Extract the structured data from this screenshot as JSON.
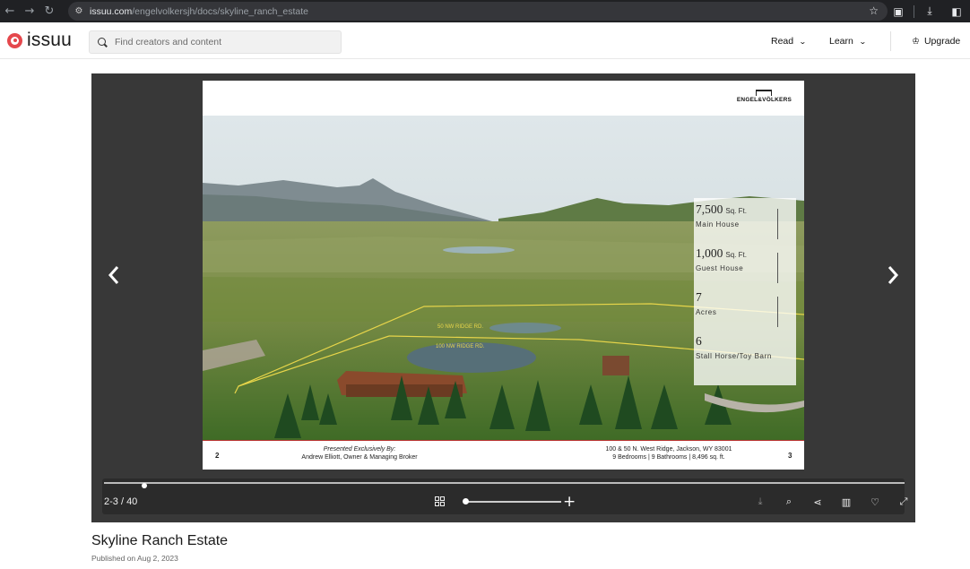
{
  "browser": {
    "url_host": "issuu.com",
    "url_path": "/engelvolkersjh/docs/skyline_ranch_estate",
    "icons": [
      "back-icon",
      "forward-icon",
      "reload-icon",
      "site-settings-icon",
      "bookmark-star-icon",
      "extensions-icon",
      "download-icon",
      "sidebar-icon"
    ]
  },
  "header": {
    "logo_text": "issuu",
    "search_placeholder": "Find creators and content",
    "menu": [
      {
        "label": "Read"
      },
      {
        "label": "Learn"
      }
    ],
    "upgrade_label": "Upgrade",
    "brand_color": "#e5484d"
  },
  "reader": {
    "brand": "ENGEL&VÖLKERS",
    "photo_labels": [
      "50 NW RIDGE RD.",
      "100 NW RIDGE RD."
    ],
    "stats": [
      {
        "num": "7,500",
        "unit": "Sq. Ft.",
        "label": "Main House"
      },
      {
        "num": "1,000",
        "unit": "Sq. Ft.",
        "label": "Guest House"
      },
      {
        "num": "7",
        "unit": "",
        "label": "Acres"
      },
      {
        "num": "6",
        "unit": "",
        "label": "Stall Horse/Toy Barn"
      }
    ],
    "footer": {
      "left_page": "2",
      "right_page": "3",
      "presented_line1": "Presented Exclusively By:",
      "presented_line2": "Andrew Elliott, Owner & Managing Broker",
      "address_line1": "100 & 50 N. West Ridge, Jackson, WY 83001",
      "address_line2": "9 Bedrooms | 9 Bathrooms | 8,496 sq. ft."
    },
    "pages_indicator": "2-3 / 40",
    "progress": 0.05,
    "zoom_level": 0
  },
  "document": {
    "title": "Skyline Ranch Estate",
    "published": "Published on Aug 2, 2023"
  }
}
